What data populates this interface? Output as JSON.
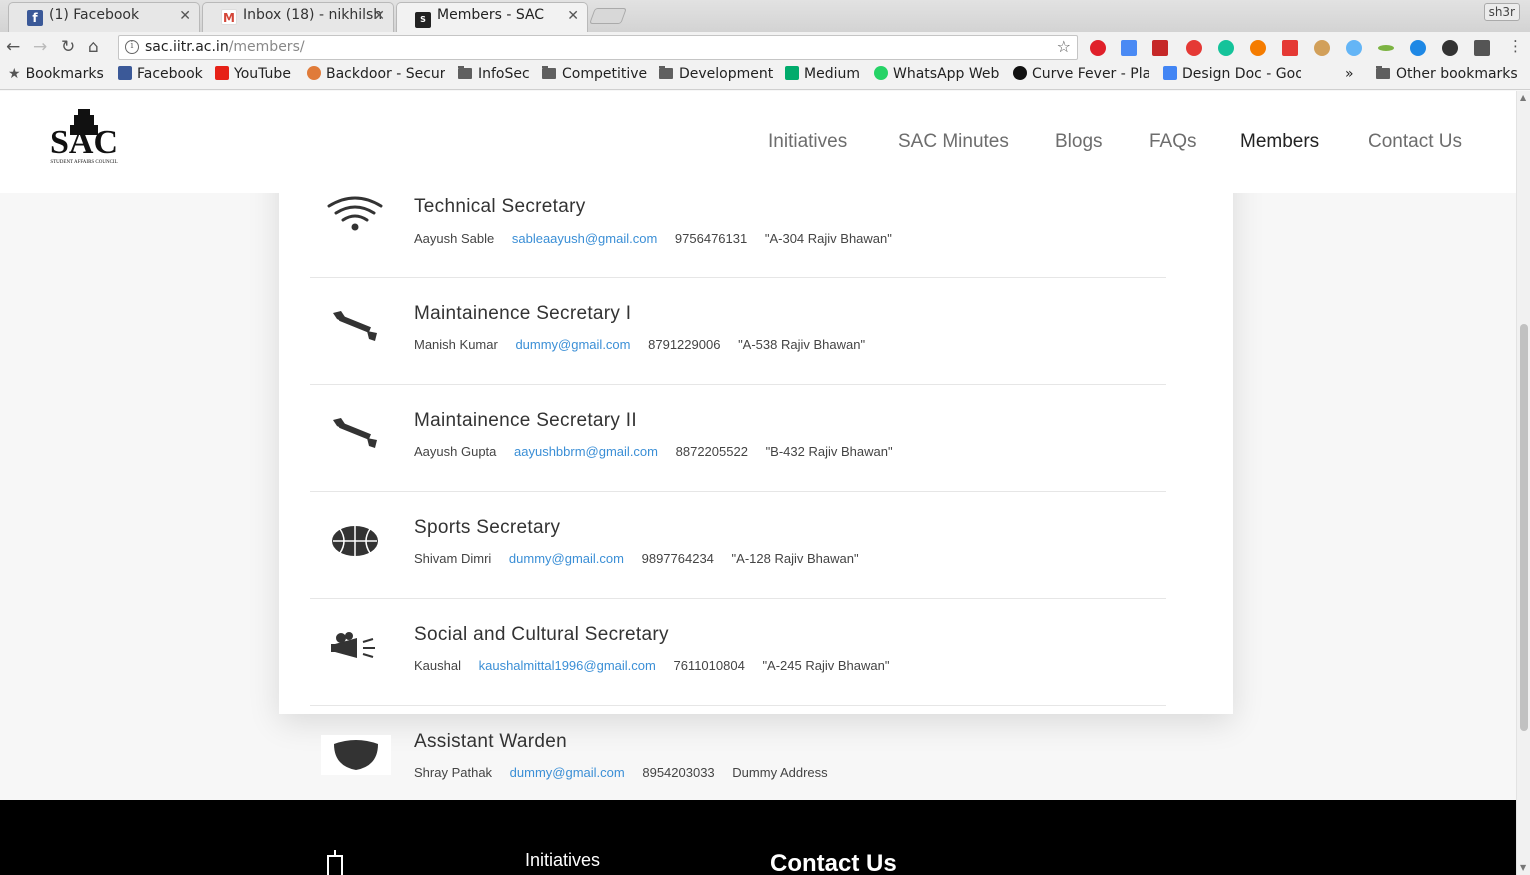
{
  "browser": {
    "tabs": [
      {
        "label": "(1) Facebook",
        "favicon": "facebook-icon"
      },
      {
        "label": "Inbox (18) - nikhilsh",
        "favicon": "gmail-icon"
      },
      {
        "label": "Members - SAC",
        "favicon": "sac-icon"
      }
    ],
    "profile": "sh3r",
    "url_host": "sac.iitr.ac.in",
    "url_path": "/members/"
  },
  "bookmarks": [
    {
      "label": "Bookmarks",
      "icon": "star-icon"
    },
    {
      "label": "Facebook",
      "icon": "facebook-icon"
    },
    {
      "label": "YouTube",
      "icon": "youtube-icon"
    },
    {
      "label": "Backdoor - Secur",
      "icon": "backdoor-icon"
    },
    {
      "label": "InfoSec",
      "icon": "folder-icon"
    },
    {
      "label": "Competitive",
      "icon": "folder-icon"
    },
    {
      "label": "Development",
      "icon": "folder-icon"
    },
    {
      "label": "Medium",
      "icon": "medium-icon"
    },
    {
      "label": "WhatsApp Web",
      "icon": "whatsapp-icon"
    },
    {
      "label": "Curve Fever - Play",
      "icon": "curve-fever-icon"
    },
    {
      "label": "Design Doc - Goo",
      "icon": "docs-icon"
    },
    {
      "label": "»",
      "icon": "overflow-icon"
    },
    {
      "label": "Other bookmarks",
      "icon": "folder-icon"
    }
  ],
  "site": {
    "logo_text": "SAC",
    "logo_subtext": "STUDENT AFFAIRS COUNCIL",
    "nav": [
      {
        "label": "Initiatives",
        "active": false
      },
      {
        "label": "SAC Minutes",
        "active": false
      },
      {
        "label": "Blogs",
        "active": false
      },
      {
        "label": "FAQs",
        "active": false
      },
      {
        "label": "Members",
        "active": true
      },
      {
        "label": "Contact Us",
        "active": false
      }
    ]
  },
  "members": [
    {
      "title": "Technical Secretary",
      "name": "Aayush Sable",
      "email": "sableaayush@gmail.com",
      "phone": "9756476131",
      "address": "\"A-304 Rajiv Bhawan\"",
      "icon": "wifi-icon"
    },
    {
      "title": "Maintainence Secretary I",
      "name": "Manish Kumar",
      "email": "dummy@gmail.com",
      "phone": "8791229006",
      "address": "\"A-538 Rajiv Bhawan\"",
      "icon": "wrench-icon"
    },
    {
      "title": "Maintainence Secretary II",
      "name": "Aayush Gupta",
      "email": "aayushbbrm@gmail.com",
      "phone": "8872205522",
      "address": "\"B-432 Rajiv Bhawan\"",
      "icon": "wrench-icon"
    },
    {
      "title": "Sports Secretary",
      "name": "Shivam Dimri",
      "email": "dummy@gmail.com",
      "phone": "9897764234",
      "address": "\"A-128 Rajiv Bhawan\"",
      "icon": "basketball-icon"
    },
    {
      "title": "Social and Cultural Secretary",
      "name": "Kaushal",
      "email": "kaushalmittal1996@gmail.com",
      "phone": "7611010804",
      "address": "\"A-245 Rajiv Bhawan\"",
      "icon": "megaphone-icon"
    },
    {
      "title": "Assistant Warden",
      "name": "Shray Pathak",
      "email": "dummy@gmail.com",
      "phone": "8954203033",
      "address": "Dummy Address",
      "icon": "mask-icon"
    }
  ],
  "footer": {
    "initiatives_heading": "Initiatives",
    "contact_heading": "Contact Us"
  }
}
